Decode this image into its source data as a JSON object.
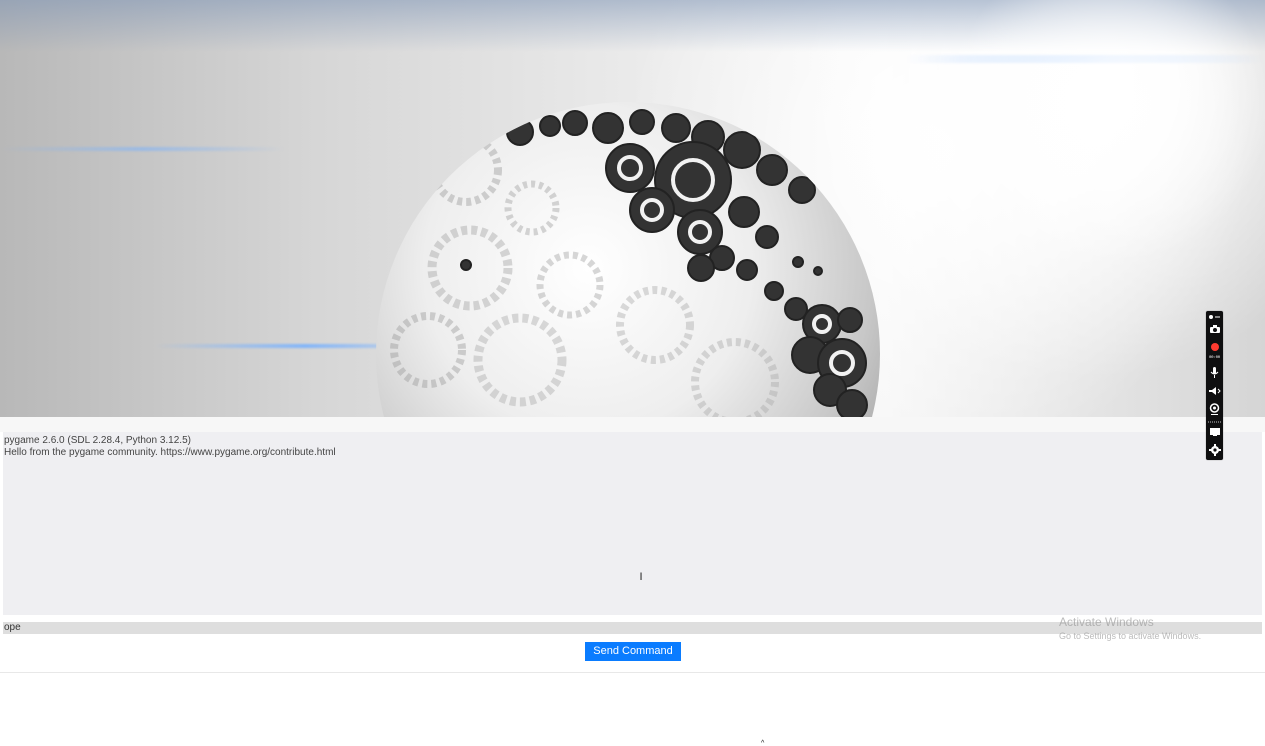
{
  "console": {
    "lines": [
      "pygame 2.6.0 (SDL 2.28.4, Python 3.12.5)",
      "Hello from the pygame community. https://www.pygame.org/contribute.html"
    ]
  },
  "command": {
    "value": "ope"
  },
  "send_button": {
    "label": "Send Command"
  },
  "windows_activation": {
    "title": "Activate Windows",
    "subtitle": "Go to Settings to activate Windows."
  },
  "recorder_toolbar": {
    "timer": "00:00"
  },
  "icons": {
    "text_cursor": "I",
    "mouse_caret": "^",
    "record_color": "#ff3b30",
    "button_color": "#0a7cff"
  },
  "hero": {
    "image_name": "gear-globe-image"
  }
}
